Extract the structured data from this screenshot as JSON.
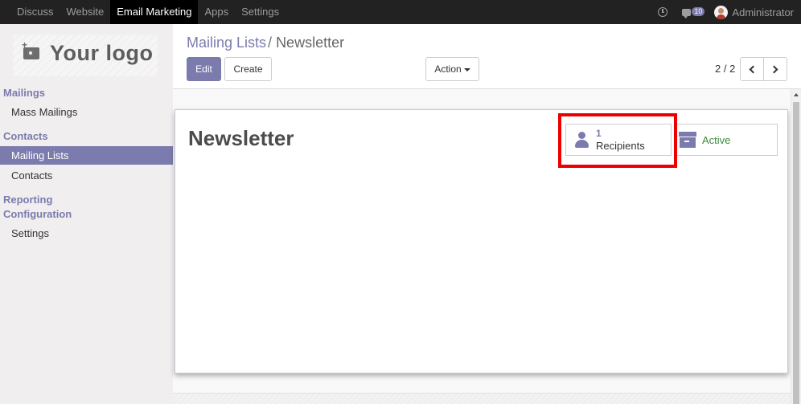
{
  "topnav": {
    "items": [
      {
        "label": "Discuss"
      },
      {
        "label": "Website"
      },
      {
        "label": "Email Marketing"
      },
      {
        "label": "Apps"
      },
      {
        "label": "Settings"
      }
    ],
    "active_item": "Email Marketing",
    "activity_icon": "clock-icon",
    "messages_icon": "chat-icon",
    "message_count": "10",
    "user_name": "Administrator"
  },
  "sidebar": {
    "logo_text": "Your logo",
    "sections": {
      "mailings": "Mailings",
      "contacts": "Contacts",
      "reporting": "Reporting",
      "configuration": "Configuration"
    },
    "items": {
      "mass_mailings": "Mass Mailings",
      "mailing_lists": "Mailing Lists",
      "contacts": "Contacts",
      "settings": "Settings"
    },
    "active_item": "Mailing Lists"
  },
  "breadcrumb": {
    "parent": "Mailing Lists",
    "separator": "/",
    "current": "Newsletter"
  },
  "toolbar": {
    "edit_label": "Edit",
    "create_label": "Create",
    "action_label": "Action"
  },
  "pager": {
    "value": "2 / 2"
  },
  "record": {
    "title": "Newsletter",
    "recipients_count": "1",
    "recipients_label": "Recipients",
    "status_label": "Active"
  },
  "colors": {
    "brand": "#7c7bad",
    "navbar": "#222222",
    "active_status": "#3c8b3c",
    "highlight": "#ee0000"
  }
}
